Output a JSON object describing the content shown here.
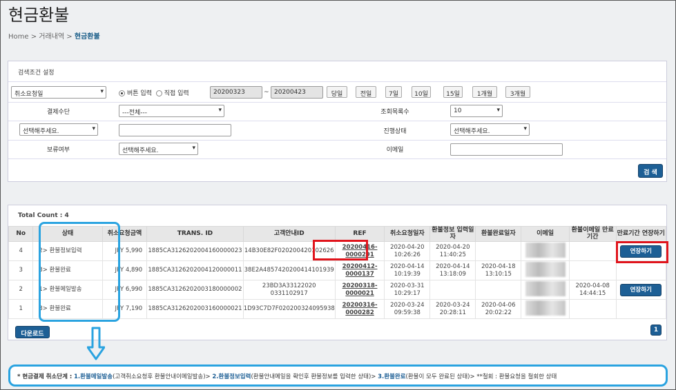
{
  "page": {
    "title": "현금환불"
  },
  "breadcrumb": {
    "home": "Home",
    "sep1": ">",
    "mid": "거래내역",
    "sep2": ">",
    "current": "현금환불"
  },
  "search": {
    "heading": "검색조건 설정",
    "date_type": "취소요청일",
    "radio_button": "버튼 입력",
    "radio_direct": "직접 입력",
    "date_from": "20200323",
    "date_tilde": "~",
    "date_to": "20200423",
    "quick_buttons": [
      "당일",
      "전일",
      "7일",
      "10일",
      "15일",
      "1개월",
      "3개월"
    ],
    "payment_label": "결제수단",
    "payment_value": "---전체---",
    "rows_label": "조회목록수",
    "rows_value": "10",
    "extra_select": "선택해주세요.",
    "extra_input": "",
    "progress_label": "진행상태",
    "progress_value": "선택해주세요.",
    "hold_label": "보류여부",
    "hold_value": "선택해주세요.",
    "email_label": "이메일",
    "email_value": "",
    "search_button": "검 색"
  },
  "results": {
    "total_count": "Total Count : 4",
    "columns": [
      "No",
      "상태",
      "취소요청금액",
      "TRANS. ID",
      "고객안내ID",
      "REF",
      "취소요청일자",
      "환불정보 입력일자",
      "환불완료일자",
      "이메일",
      "환불이메일 만료기간",
      "만료기간 연장하기"
    ],
    "rows": [
      {
        "no": "4",
        "status": "2> 환불정보입력",
        "amount": "JPY 5,990",
        "trans_id": "1885CA3126202004160000023",
        "guide_id": "14B30E82F020200420102626",
        "ref": "20200416-0000291",
        "req_date": "2020-04-20 10:26:26",
        "info_date": "2020-04-20 11:40:25",
        "done_date": "",
        "expire": "",
        "extend": "연장하기"
      },
      {
        "no": "3",
        "status": "3> 환불완료",
        "amount": "JPY 4,890",
        "trans_id": "1885CA3126202004120000011",
        "guide_id": "38E2A4857420200414101939",
        "ref": "20200412-0000137",
        "req_date": "2020-04-14 10:19:39",
        "info_date": "2020-04-14 13:18:09",
        "done_date": "2020-04-18 13:10:15",
        "expire": "",
        "extend": ""
      },
      {
        "no": "2",
        "status": "1> 환불메일발송",
        "amount": "JPY 6,990",
        "trans_id": "1885CA3126202003180000002",
        "guide_id": "23BD3A33122020 0331102917",
        "ref": "20200318-0000021",
        "req_date": "2020-03-31 10:29:17",
        "info_date": "",
        "done_date": "",
        "expire": "2020-04-08 14:44:15",
        "extend": "연장하기"
      },
      {
        "no": "1",
        "status": "3> 환불완료",
        "amount": "JPY 7,190",
        "trans_id": "1885CA3126202003160000021",
        "guide_id": "1D93C7D7F020200324095938",
        "ref": "20200316-0000282",
        "req_date": "2020-03-24 09:59:38",
        "info_date": "2020-03-24 20:28:11",
        "done_date": "2020-04-06 20:02:22",
        "expire": "",
        "extend": ""
      }
    ],
    "download_button": "다운로드",
    "page_number": "1"
  },
  "notice": {
    "prefix": "* 현금결제 취소단계 :",
    "step1": "1.환불메일발송",
    "step1_desc": "(고객취소요청후 환불안내이메일발송)>",
    "step2": "2.환불정보입력",
    "step2_desc": "(환불안내메일을 확인후 환불정보를 입력한 상태)>",
    "step3": "3.환불완료",
    "step3_desc": "(환불이 모두 완료된 상태)>",
    "withdraw": "**철회 : 환불요청을 철회한 상태"
  },
  "colors": {
    "accent": "#1d5f95",
    "highlight_red": "#e0141c",
    "highlight_cyan": "#2aa3e0"
  },
  "icons": {
    "arrow": "down-arrow-icon"
  }
}
